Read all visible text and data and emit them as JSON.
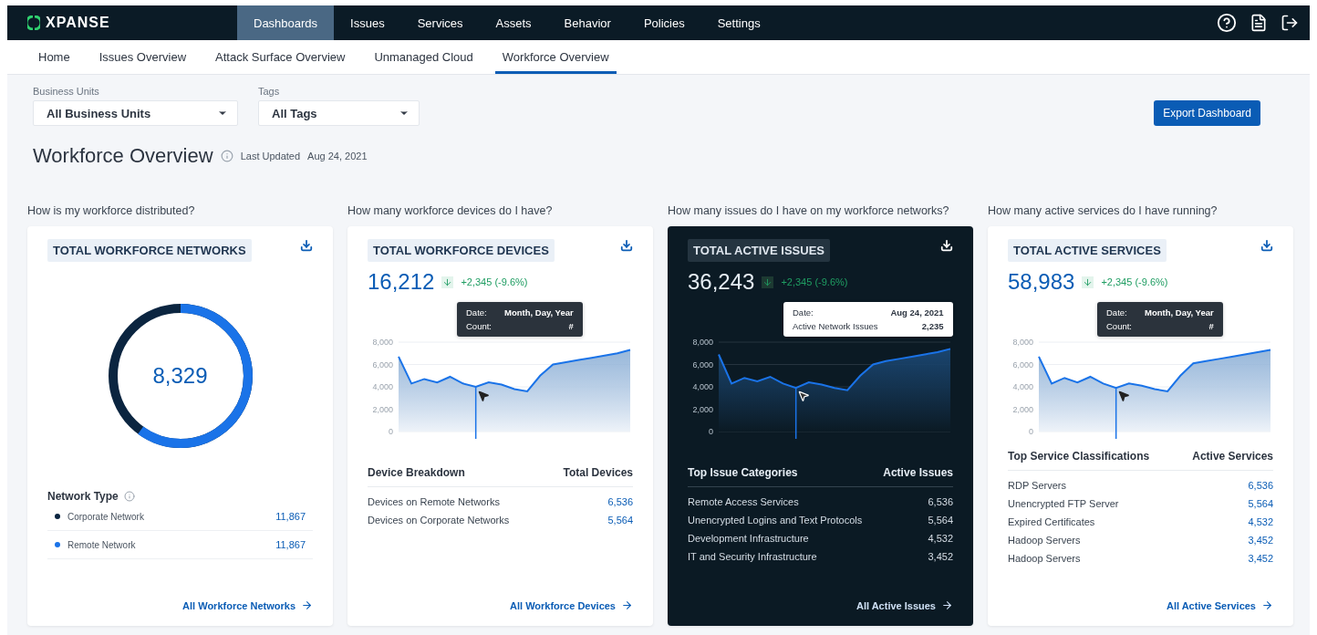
{
  "top_nav": {
    "logo": "XPANSE",
    "items": [
      {
        "label": "Dashboards",
        "selected": true
      },
      {
        "label": "Issues",
        "selected": false
      },
      {
        "label": "Services",
        "selected": false
      },
      {
        "label": "Assets",
        "selected": false
      },
      {
        "label": "Behavior",
        "selected": false
      },
      {
        "label": "Policies",
        "selected": false
      },
      {
        "label": "Settings",
        "selected": false
      }
    ]
  },
  "sub_nav": [
    {
      "label": "Home",
      "selected": false
    },
    {
      "label": "Issues Overview",
      "selected": false
    },
    {
      "label": "Attack Surface Overview",
      "selected": false
    },
    {
      "label": "Unmanaged Cloud",
      "selected": false
    },
    {
      "label": "Workforce Overview",
      "selected": true
    }
  ],
  "filters": [
    {
      "label": "Business Units",
      "value": "All Business Units"
    },
    {
      "label": "Tags",
      "value": "All Tags"
    }
  ],
  "export_button": "Export Dashboard",
  "page_title": "Workforce Overview",
  "last_updated_label": "Last Updated",
  "last_updated": "Aug 24, 2021",
  "cards": [
    {
      "kind": "donut",
      "question": "How is my workforce distributed?",
      "title": "TOTAL WORKFORCE NETWORKS",
      "total": "8,329",
      "legend_title": "Network Type",
      "legend": [
        {
          "label": "Corporate Network",
          "value": "11,867",
          "color": "#0b2540"
        },
        {
          "label": "Remote Network",
          "value": "11,867",
          "color": "#1a73e8"
        }
      ],
      "link": "All Workforce Networks"
    },
    {
      "kind": "area",
      "question": "How many workforce devices do I have?",
      "title": "TOTAL WORKFORCE DEVICES",
      "total": "16,212",
      "delta": "+2,345 (-9.6%)",
      "chart_data": {
        "type": "area",
        "ylim": [
          0,
          8000
        ],
        "yticks": [
          {
            "value": 0,
            "label": "0"
          },
          {
            "value": 2000,
            "label": "2,000"
          },
          {
            "value": 4000,
            "label": "4,000"
          },
          {
            "value": 6000,
            "label": "6,000"
          },
          {
            "value": 8000,
            "label": "8,000"
          }
        ],
        "grid": true,
        "series": [
          {
            "color": "#1a73e8",
            "values": [
              6700,
              4300,
              4700,
              4400,
              4900,
              4300,
              4000,
              4400,
              4200,
              3800,
              3600,
              5000,
              6000,
              6200,
              6400,
              6600,
              6800,
              7000,
              7300
            ]
          }
        ]
      },
      "tooltip": [
        {
          "label": "Date:",
          "value": "Month, Day, Year"
        },
        {
          "label": "Count:",
          "value": "#"
        }
      ],
      "table": {
        "columns": [
          "Device Breakdown",
          "Total Devices"
        ],
        "rows": [
          {
            "name": "Devices on Remote Networks",
            "value": "6,536"
          },
          {
            "name": "Devices on Corporate Networks",
            "value": "5,564"
          }
        ]
      },
      "link": "All Workforce Devices"
    },
    {
      "kind": "darkarea",
      "question": "How many issues do I have on my workforce networks?",
      "title": "TOTAL ACTIVE ISSUES",
      "total": "36,243",
      "delta": "+2,345 (-9.6%)",
      "chart_data": {
        "type": "area",
        "ylim": [
          0,
          8000
        ],
        "yticks": [
          {
            "value": 0,
            "label": "0"
          },
          {
            "value": 2000,
            "label": "2,000"
          },
          {
            "value": 4000,
            "label": "4,000"
          },
          {
            "value": 6000,
            "label": "6,000"
          },
          {
            "value": 8000,
            "label": "8,000"
          }
        ],
        "grid": true,
        "series": [
          {
            "color": "#1a73e8",
            "values": [
              6900,
              4300,
              4800,
              4500,
              4900,
              4300,
              3900,
              4400,
              4200,
              3900,
              3700,
              5000,
              6000,
              6300,
              6500,
              6700,
              6900,
              7100,
              7400
            ]
          }
        ]
      },
      "tooltip": [
        {
          "label": "Date:",
          "value": "Aug 24, 2021"
        },
        {
          "label": "Active Network Issues",
          "value": "2,235"
        }
      ],
      "table": {
        "columns": [
          "Top Issue Categories",
          "Active Issues"
        ],
        "rows": [
          {
            "name": "Remote Access Services",
            "value": "6,536"
          },
          {
            "name": "Unencrypted Logins and Text Protocols",
            "value": "5,564"
          },
          {
            "name": "Development Infrastructure",
            "value": "4,532"
          },
          {
            "name": "IT and Security Infrastructure",
            "value": "3,452"
          }
        ]
      },
      "link": "All Active Issues"
    },
    {
      "kind": "area",
      "question": "How many active services do I have running?",
      "title": "TOTAL ACTIVE SERVICES",
      "total": "58,983",
      "delta": "+2,345 (-9.6%)",
      "chart_data": {
        "type": "area",
        "ylim": [
          0,
          8000
        ],
        "yticks": [
          {
            "value": 0,
            "label": "0"
          },
          {
            "value": 2000,
            "label": "2,000"
          },
          {
            "value": 4000,
            "label": "4,000"
          },
          {
            "value": 6000,
            "label": "6,000"
          },
          {
            "value": 8000,
            "label": "8,000"
          }
        ],
        "grid": true,
        "series": [
          {
            "color": "#1a73e8",
            "values": [
              6700,
              4300,
              4800,
              4400,
              4900,
              4300,
              3900,
              4300,
              4100,
              3800,
              3600,
              5000,
              6100,
              6300,
              6500,
              6700,
              6900,
              7100,
              7300
            ]
          }
        ]
      },
      "tooltip": [
        {
          "label": "Date:",
          "value": "Month, Day, Year"
        },
        {
          "label": "Count:",
          "value": "#"
        }
      ],
      "table": {
        "columns": [
          "Top Service Classifications",
          "Active Services"
        ],
        "rows": [
          {
            "name": "RDP Servers",
            "value": "6,536"
          },
          {
            "name": "Unencrypted FTP Server",
            "value": "5,564"
          },
          {
            "name": "Expired Certificates",
            "value": "4,532"
          },
          {
            "name": "Hadoop Servers",
            "value": "3,452"
          },
          {
            "name": "Hadoop Servers",
            "value": "3,452"
          }
        ]
      },
      "link": "All Active Services"
    }
  ]
}
